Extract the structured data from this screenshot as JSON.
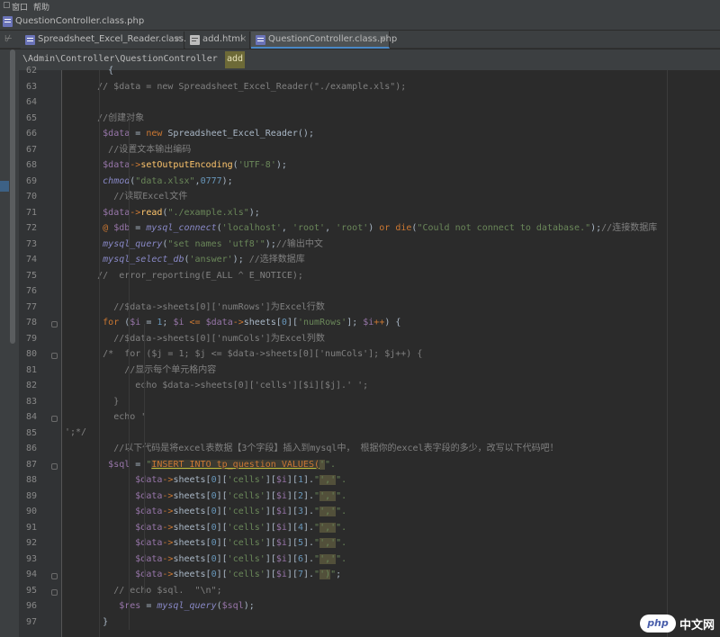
{
  "menubar": {
    "items": [
      "窗口",
      "帮助"
    ]
  },
  "breadcrumb": {
    "file": "QuestionController.class.php"
  },
  "tabs": [
    {
      "label": "Spreadsheet_Excel_Reader.class.php",
      "active": false
    },
    {
      "label": "add.html",
      "active": false
    },
    {
      "label": "QuestionController.class.php",
      "active": true
    }
  ],
  "editor_path": {
    "namespace": "\\Admin\\Controller\\QuestionController",
    "method": "add"
  },
  "lines": [
    {
      "n": "62",
      "html": "        {"
    },
    {
      "n": "63",
      "html": "      <span class=\"c-com\">// $data = new Spreadsheet_Excel_Reader(\"./example.xls\");</span>"
    },
    {
      "n": "64",
      "html": ""
    },
    {
      "n": "65",
      "html": "      <span class=\"c-com\">//创建对象</span>"
    },
    {
      "n": "66",
      "html": "       <span class=\"c-var\">$data</span> = <span class=\"c-kw\">new</span> Spreadsheet_Excel_Reader();"
    },
    {
      "n": "67",
      "html": "        <span class=\"c-com\">//设置文本输出编码</span>"
    },
    {
      "n": "68",
      "html": "       <span class=\"c-var\">$data</span><span class=\"c-kw\">-></span><span class=\"c-fn\">setOutputEncoding</span>(<span class=\"c-str\">'UTF-8'</span>);"
    },
    {
      "n": "69",
      "html": "       <span class=\"c-native\">chmod</span>(<span class=\"c-str\">\"data.xlsx\"</span>,<span class=\"c-num\">0777</span>);"
    },
    {
      "n": "70",
      "html": "         <span class=\"c-com\">//读取Excel文件</span>"
    },
    {
      "n": "71",
      "html": "       <span class=\"c-var\">$data</span><span class=\"c-kw\">-></span><span class=\"c-fn\">read</span>(<span class=\"c-str\">\"./example.xls\"</span>);"
    },
    {
      "n": "72",
      "html": "       <span class=\"c-kw\">@</span> <span class=\"c-var\">$db</span> = <span class=\"c-native\">mysql_connect</span>(<span class=\"c-str\">'localhost'</span>, <span class=\"c-str\">'root'</span>, <span class=\"c-str\">'root'</span>) <span class=\"c-kw\">or</span> <span class=\"c-kw\">die</span>(<span class=\"c-str\">\"Could not connect to database.\"</span>);<span class=\"c-com\">//连接数据库</span>"
    },
    {
      "n": "73",
      "html": "       <span class=\"c-native\">mysql_query</span>(<span class=\"c-str\">\"set names 'utf8'\"</span>);<span class=\"c-com\">//输出中文</span>"
    },
    {
      "n": "74",
      "html": "       <span class=\"c-native\">mysql_select_db</span>(<span class=\"c-str\">'answer'</span>); <span class=\"c-com\">//选择数据库</span>"
    },
    {
      "n": "75",
      "html": "      <span class=\"c-com\">//  error_reporting(E_ALL ^ E_NOTICE);</span>"
    },
    {
      "n": "76",
      "html": ""
    },
    {
      "n": "77",
      "html": "         <span class=\"c-com\">//$data->sheets[0]['numRows']为Excel行数</span>"
    },
    {
      "n": "78",
      "html": "       <span class=\"c-kw\">for</span> (<span class=\"c-var\">$i</span> = <span class=\"c-num\">1</span>; <span class=\"c-var\">$i</span> <span class=\"c-kw\"><=</span> <span class=\"c-var\">$data</span><span class=\"c-kw\">-></span>sheets[<span class=\"c-num\">0</span>][<span class=\"c-str\">'numRows'</span>]; <span class=\"c-var\">$i</span><span class=\"c-kw\">++</span>) {"
    },
    {
      "n": "79",
      "html": "         <span class=\"c-com\">//$data->sheets[0]['numCols']为Excel列数</span>"
    },
    {
      "n": "80",
      "html": "       <span class=\"c-com\">/*  for ($j = 1; $j <= $data->sheets[0]['numCols']; $j++) {</span>"
    },
    {
      "n": "81",
      "html": "           <span class=\"c-com\">//显示每个单元格内容</span>"
    },
    {
      "n": "82",
      "html": "             <span class=\"c-com\">echo $data->sheets[0]['cells'][$i][$j].' ';</span>"
    },
    {
      "n": "83",
      "html": "         <span class=\"c-com\">}</span>"
    },
    {
      "n": "84",
      "html": "         <span class=\"c-com\">echo '<br>';*/</span>"
    },
    {
      "n": "85",
      "html": ""
    },
    {
      "n": "86",
      "html": "         <span class=\"c-com\">//以下代码是将excel表数据【3个字段】插入到mysql中， 根据你的excel表字段的多少，改写以下代码吧！</span>"
    },
    {
      "n": "87",
      "html": "        <span class=\"c-var\">$sql</span> = <span class=\"c-str\">\"</span><span class=\"c-sql\">INSERT INTO tp_question VALUES(</span><span class=\"c-hl\">'</span><span class=\"c-str\">\".</span>"
    },
    {
      "n": "88",
      "html": "             <span class=\"c-var\">$data</span><span class=\"c-kw\">-></span>sheets[<span class=\"c-num\">0</span>][<span class=\"c-str\">'cells'</span>][<span class=\"c-var\">$i</span>][<span class=\"c-num\">1</span>].<span class=\"c-str\">\"</span><span class=\"c-hl\">','</span><span class=\"c-str\">\".</span>"
    },
    {
      "n": "89",
      "html": "             <span class=\"c-var\">$data</span><span class=\"c-kw\">-></span>sheets[<span class=\"c-num\">0</span>][<span class=\"c-str\">'cells'</span>][<span class=\"c-var\">$i</span>][<span class=\"c-num\">2</span>].<span class=\"c-str\">\"</span><span class=\"c-hl\">','</span><span class=\"c-str\">\".</span>"
    },
    {
      "n": "90",
      "html": "             <span class=\"c-var\">$data</span><span class=\"c-kw\">-></span>sheets[<span class=\"c-num\">0</span>][<span class=\"c-str\">'cells'</span>][<span class=\"c-var\">$i</span>][<span class=\"c-num\">3</span>].<span class=\"c-str\">\"</span><span class=\"c-hl\">','</span><span class=\"c-str\">\".</span>"
    },
    {
      "n": "91",
      "html": "             <span class=\"c-var\">$data</span><span class=\"c-kw\">-></span>sheets[<span class=\"c-num\">0</span>][<span class=\"c-str\">'cells'</span>][<span class=\"c-var\">$i</span>][<span class=\"c-num\">4</span>].<span class=\"c-str\">\"</span><span class=\"c-hl\">','</span><span class=\"c-str\">\".</span>"
    },
    {
      "n": "92",
      "html": "             <span class=\"c-var\">$data</span><span class=\"c-kw\">-></span>sheets[<span class=\"c-num\">0</span>][<span class=\"c-str\">'cells'</span>][<span class=\"c-var\">$i</span>][<span class=\"c-num\">5</span>].<span class=\"c-str\">\"</span><span class=\"c-hl\">','</span><span class=\"c-str\">\".</span>"
    },
    {
      "n": "93",
      "html": "             <span class=\"c-var\">$data</span><span class=\"c-kw\">-></span>sheets[<span class=\"c-num\">0</span>][<span class=\"c-str\">'cells'</span>][<span class=\"c-var\">$i</span>][<span class=\"c-num\">6</span>].<span class=\"c-str\">\"</span><span class=\"c-hl\">','</span><span class=\"c-str\">\".</span>"
    },
    {
      "n": "94",
      "html": "             <span class=\"c-var\">$data</span><span class=\"c-kw\">-></span>sheets[<span class=\"c-num\">0</span>][<span class=\"c-str\">'cells'</span>][<span class=\"c-var\">$i</span>][<span class=\"c-num\">7</span>].<span class=\"c-str\">\"</span><span class=\"c-hl\">')</span><span class=\"c-str\">\"</span>;"
    },
    {
      "n": "95",
      "html": "         <span class=\"c-com\">// echo $sql.  \"\\n\";</span>"
    },
    {
      "n": "96",
      "html": "          <span class=\"c-var\">$res</span> = <span class=\"c-native\">mysql_query</span>(<span class=\"c-var\">$sql</span>);"
    },
    {
      "n": "97",
      "html": "       }"
    }
  ],
  "fold_lines": [
    "78",
    "80",
    "84",
    "87",
    "94",
    "95"
  ],
  "watermark": {
    "logo": "php",
    "text": "中文网"
  },
  "colors": {
    "background": "#2b2b2b",
    "gutter": "#313335",
    "active_tab_underline": "#4a88c7",
    "path_highlight": "#6d6a37"
  }
}
